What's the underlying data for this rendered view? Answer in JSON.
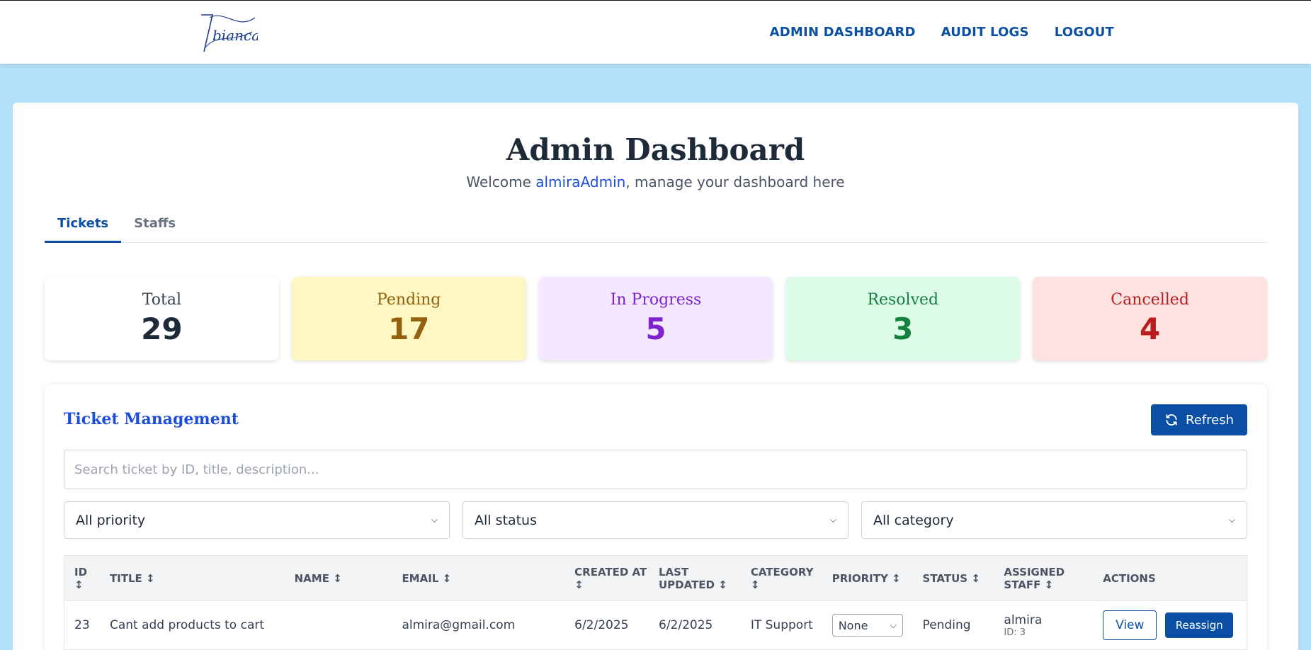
{
  "nav": {
    "logo_text": "bianca",
    "items": [
      "ADMIN DASHBOARD",
      "AUDIT LOGS",
      "LOGOUT"
    ]
  },
  "header": {
    "title": "Admin Dashboard",
    "welcome_prefix": "Welcome ",
    "username": "almiraAdmin",
    "welcome_suffix": ", manage your dashboard here"
  },
  "tabs": [
    "Tickets",
    "Staffs"
  ],
  "stats": [
    {
      "label": "Total",
      "value": "29"
    },
    {
      "label": "Pending",
      "value": "17"
    },
    {
      "label": "In Progress",
      "value": "5"
    },
    {
      "label": "Resolved",
      "value": "3"
    },
    {
      "label": "Cancelled",
      "value": "4"
    }
  ],
  "panel": {
    "title": "Ticket Management",
    "refresh_label": "Refresh",
    "search_placeholder": "Search ticket by ID, title, description..."
  },
  "filters": [
    "All priority",
    "All status",
    "All category"
  ],
  "table": {
    "headers": [
      "ID",
      "TITLE",
      "NAME",
      "EMAIL",
      "CREATED AT",
      "LAST UPDATED",
      "CATEGORY",
      "PRIORITY",
      "STATUS",
      "ASSIGNED STAFF",
      "ACTIONS"
    ],
    "rows": [
      {
        "id": "23",
        "title": "Cant add products to cart",
        "name": "",
        "email": "almira@gmail.com",
        "created": "6/2/2025",
        "updated": "6/2/2025",
        "category": "IT Support",
        "priority": "None",
        "status": "Pending",
        "staff": "almira",
        "staff_id": "ID: 3",
        "view": "View",
        "reassign": "Reassign"
      }
    ]
  },
  "colors": {
    "brand": "#0a4fa3",
    "background": "#b3e0f9"
  }
}
